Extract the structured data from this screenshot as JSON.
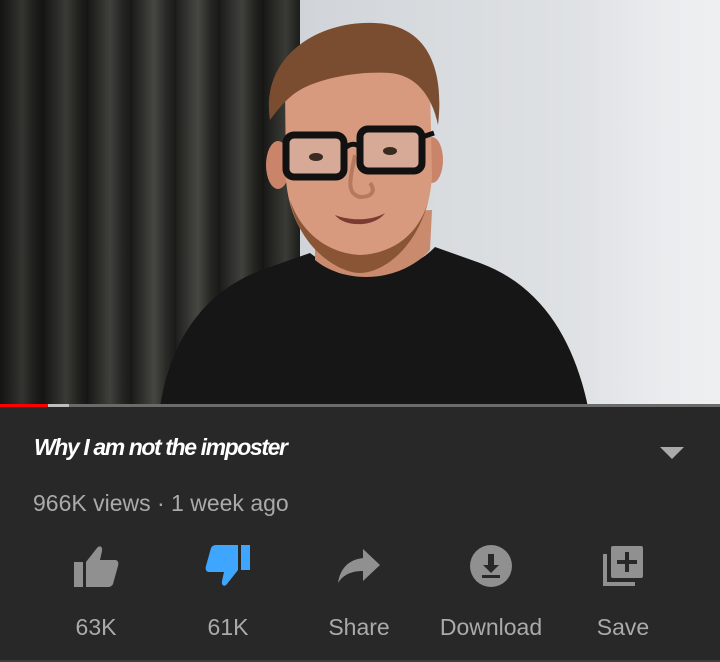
{
  "video": {
    "progress": {
      "played_fraction": 0.067,
      "buffered_fraction": 0.096
    }
  },
  "info": {
    "title": "Why I am not the imposter",
    "meta": "966K views · 1 week ago",
    "actions": [
      {
        "id": "like",
        "label": "63K",
        "icon": "thumbs-up-icon",
        "active": false
      },
      {
        "id": "dislike",
        "label": "61K",
        "icon": "thumbs-down-icon",
        "active": true
      },
      {
        "id": "share",
        "label": "Share",
        "icon": "share-arrow-icon",
        "active": false
      },
      {
        "id": "download",
        "label": "Download",
        "icon": "download-icon",
        "active": false
      },
      {
        "id": "save",
        "label": "Save",
        "icon": "add-to-playlist-icon",
        "active": false
      }
    ]
  },
  "colors": {
    "panel_bg": "#282828",
    "title_text": "#ffffff",
    "secondary_text": "#aaaaaa",
    "icon_default": "#909090",
    "icon_active": "#3ea6ff",
    "progress_played": "#ff0000"
  }
}
